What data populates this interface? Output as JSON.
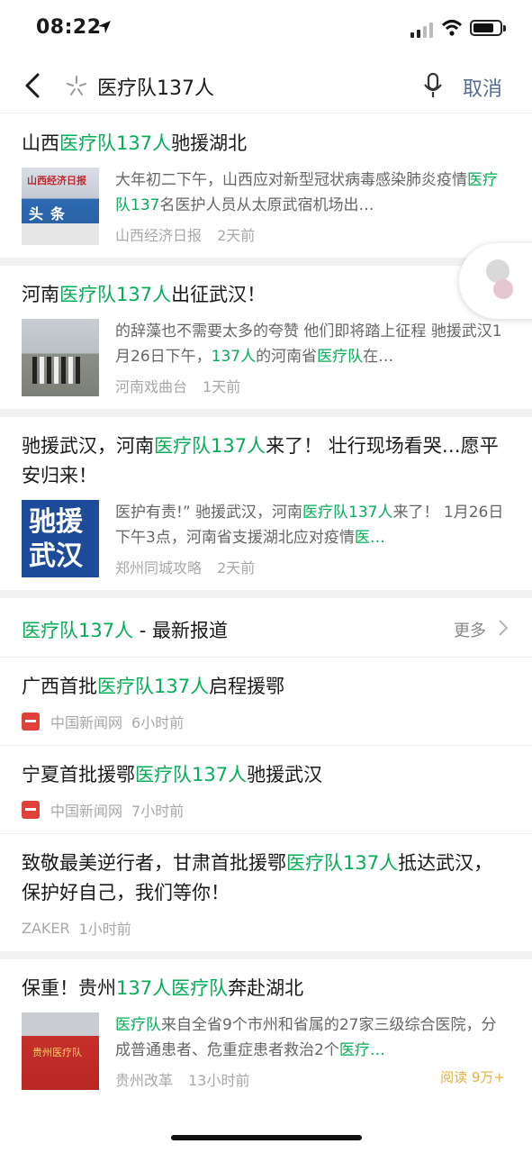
{
  "status_bar": {
    "time": "08:22"
  },
  "search": {
    "query": "医疗队137人",
    "cancel_label": "取消"
  },
  "results": [
    {
      "title_parts": [
        [
          "山西",
          false
        ],
        [
          "医疗队137人",
          true
        ],
        [
          "驰援湖北",
          false
        ]
      ],
      "summary_parts": [
        [
          "大年初二下午，山西应对新型冠状病毒感染肺炎疫情",
          false
        ],
        [
          "医疗队137",
          true
        ],
        [
          "名医护人员从太原武宿机场出…",
          false
        ]
      ],
      "source": "山西经济日报",
      "time": "2天前",
      "thumb_text_top": "山西经济日报",
      "thumb_text": "头条"
    },
    {
      "title_parts": [
        [
          "河南",
          false
        ],
        [
          "医疗队137人",
          true
        ],
        [
          "出征武汉！",
          false
        ]
      ],
      "summary_parts": [
        [
          "的辞藻也不需要太多的夸赞 他们即将踏上征程 驰援武汉1月26日下午，",
          false
        ],
        [
          "137人",
          true
        ],
        [
          "的河南省",
          false
        ],
        [
          "医疗队",
          true
        ],
        [
          "在…",
          false
        ]
      ],
      "source": "河南戏曲台",
      "time": "1天前"
    },
    {
      "title_parts": [
        [
          "驰援武汉，河南",
          false
        ],
        [
          "医疗队137人",
          true
        ],
        [
          "来了！ 壮行现场看哭…愿平安归来！",
          false
        ]
      ],
      "summary_parts": [
        [
          "医护有责!” 驰援武汉，河南",
          false
        ],
        [
          "医疗队137人",
          true
        ],
        [
          "来了！ 1月26日下午3点，河南省支援湖北应对疫情",
          false
        ],
        [
          "医…",
          true
        ]
      ],
      "source": "郑州同城攻略",
      "time": "2天前",
      "thumb_text": "驰援\n武汉"
    }
  ],
  "news_section": {
    "header_parts": [
      [
        "医疗队137人",
        true
      ],
      [
        " - 最新报道",
        false
      ]
    ],
    "more_label": "更多",
    "items": [
      {
        "title_parts": [
          [
            "广西首批",
            false
          ],
          [
            "医疗队137人",
            true
          ],
          [
            "启程援鄂",
            false
          ]
        ],
        "source": "中国新闻网",
        "time": "6小时前",
        "has_logo": true
      },
      {
        "title_parts": [
          [
            "宁夏首批援鄂",
            false
          ],
          [
            "医疗队137人",
            true
          ],
          [
            "驰援武汉",
            false
          ]
        ],
        "source": "中国新闻网",
        "time": "7小时前",
        "has_logo": true
      },
      {
        "title_parts": [
          [
            "致敬最美逆行者，甘肃首批援鄂",
            false
          ],
          [
            "医疗队137人",
            true
          ],
          [
            "抵达武汉，保护好自己，我们等你！",
            false
          ]
        ],
        "source": "ZAKER",
        "time": "1小时前",
        "has_logo": false
      }
    ]
  },
  "last_result": {
    "title_parts": [
      [
        "保重！贵州",
        false
      ],
      [
        "137人医疗队",
        true
      ],
      [
        "奔赴湖北",
        false
      ]
    ],
    "summary_parts": [
      [
        "医疗队",
        true
      ],
      [
        "来自全省9个市州和省属的27家三级综合医院，分成普通患者、危重症患者救治2个",
        false
      ],
      [
        "医疗…",
        true
      ]
    ],
    "source": "贵州改革",
    "time": "13小时前",
    "read_count": "阅读 9万+",
    "thumb_text": "贵州医疗队"
  },
  "colors": {
    "highlight": "#06ae56",
    "cancel": "#576b95",
    "read_count": "#e4b23e"
  },
  "icons": [
    "back-chevron-icon",
    "search-sparkle-icon",
    "microphone-icon",
    "chevron-right-icon",
    "location-arrow-icon",
    "signal-icon",
    "wifi-icon",
    "battery-icon"
  ]
}
